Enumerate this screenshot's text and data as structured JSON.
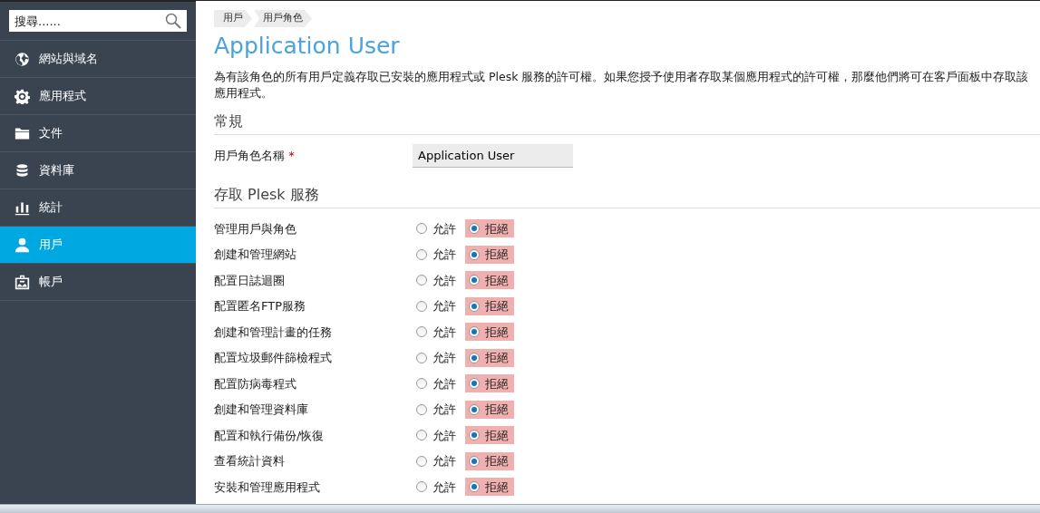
{
  "sidebar": {
    "search": {
      "placeholder": "搜尋......"
    },
    "items": [
      {
        "label": "網站與域名",
        "selected": false
      },
      {
        "label": "應用程式",
        "selected": false
      },
      {
        "label": "文件",
        "selected": false
      },
      {
        "label": "資料庫",
        "selected": false
      },
      {
        "label": "統計",
        "selected": false
      },
      {
        "label": "用戶",
        "selected": true
      },
      {
        "label": "帳戶",
        "selected": false
      }
    ]
  },
  "breadcrumb": [
    "用戶",
    "用戶角色"
  ],
  "title": "Application User",
  "description": "為有該角色的所有用戶定義存取已安裝的應用程式或 Plesk 服務的許可權。如果您授予使用者存取某個應用程式的許可權，那麼他們將可在客戶面板中存取該應用程式。",
  "general": {
    "heading": "常規",
    "field": {
      "label": "用戶角色名稱",
      "required_mark": "*",
      "value": "Application User"
    }
  },
  "services": {
    "heading": "存取 Plesk 服務",
    "permissions": [
      {
        "label": "管理用戶與角色",
        "options": [
          {
            "label": "允許",
            "selected": false
          },
          {
            "label": "拒絕",
            "selected": true
          }
        ]
      },
      {
        "label": "創建和管理網站",
        "options": [
          {
            "label": "允許",
            "selected": false
          },
          {
            "label": "拒絕",
            "selected": true
          }
        ]
      },
      {
        "label": "配置日誌迴圈",
        "options": [
          {
            "label": "允許",
            "selected": false
          },
          {
            "label": "拒絕",
            "selected": true
          }
        ]
      },
      {
        "label": "配置匿名FTP服務",
        "options": [
          {
            "label": "允許",
            "selected": false
          },
          {
            "label": "拒絕",
            "selected": true
          }
        ]
      },
      {
        "label": "創建和管理計畫的任務",
        "options": [
          {
            "label": "允許",
            "selected": false
          },
          {
            "label": "拒絕",
            "selected": true
          }
        ]
      },
      {
        "label": "配置垃圾郵件篩檢程式",
        "options": [
          {
            "label": "允許",
            "selected": false
          },
          {
            "label": "拒絕",
            "selected": true
          }
        ]
      },
      {
        "label": "配置防病毒程式",
        "options": [
          {
            "label": "允許",
            "selected": false
          },
          {
            "label": "拒絕",
            "selected": true
          }
        ]
      },
      {
        "label": "創建和管理資料庫",
        "options": [
          {
            "label": "允許",
            "selected": false
          },
          {
            "label": "拒絕",
            "selected": true
          }
        ]
      },
      {
        "label": "配置和執行備份/恢復",
        "options": [
          {
            "label": "允許",
            "selected": false
          },
          {
            "label": "拒絕",
            "selected": true
          }
        ]
      },
      {
        "label": "查看統計資料",
        "options": [
          {
            "label": "允許",
            "selected": false
          },
          {
            "label": "拒絕",
            "selected": true
          }
        ]
      },
      {
        "label": "安裝和管理應用程式",
        "options": [
          {
            "label": "允許",
            "selected": false
          },
          {
            "label": "拒絕",
            "selected": true
          }
        ]
      }
    ]
  }
}
